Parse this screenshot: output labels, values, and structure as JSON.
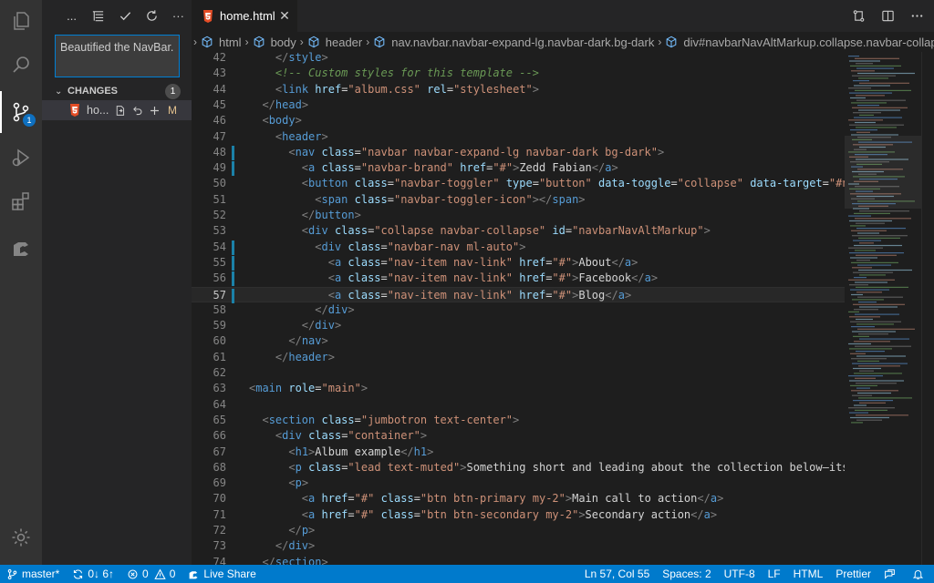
{
  "activity_bar": {
    "items": [
      "explorer-icon",
      "search-icon",
      "source-control-icon",
      "run-debug-icon",
      "extensions-icon",
      "live-share-icon"
    ],
    "scm_badge": "1"
  },
  "sidebar": {
    "toolbar": {
      "more_label": "...",
      "overflow_label": "···"
    },
    "commit_message": "Beautified the NavBar.",
    "changes": {
      "title": "CHANGES",
      "count": "1",
      "files": [
        {
          "name": "home.html",
          "short": "ho...",
          "status": "M"
        }
      ]
    }
  },
  "editor": {
    "tab": {
      "title": "home.html"
    },
    "breadcrumb": [
      "html",
      "body",
      "header",
      "nav.navbar.navbar-expand-lg.navbar-dark.bg-dark",
      "div#navbarNavAltMarkup.collapse.navbar-collapse"
    ],
    "current_line": 57,
    "lines": [
      {
        "n": 42,
        "indent": 2,
        "mod": false,
        "toks": [
          [
            "ang",
            "</"
          ],
          [
            "tag",
            "style"
          ],
          [
            "ang",
            ">"
          ]
        ]
      },
      {
        "n": 43,
        "indent": 2,
        "mod": false,
        "toks": [
          [
            "com",
            "<!-- Custom styles for this template -->"
          ]
        ]
      },
      {
        "n": 44,
        "indent": 2,
        "mod": false,
        "toks": [
          [
            "ang",
            "<"
          ],
          [
            "tag",
            "link"
          ],
          [
            "txt",
            " "
          ],
          [
            "attr",
            "href"
          ],
          [
            "eq",
            "="
          ],
          [
            "str",
            "\"album.css\""
          ],
          [
            "txt",
            " "
          ],
          [
            "attr",
            "rel"
          ],
          [
            "eq",
            "="
          ],
          [
            "str",
            "\"stylesheet\""
          ],
          [
            "ang",
            ">"
          ]
        ]
      },
      {
        "n": 45,
        "indent": 1,
        "mod": false,
        "toks": [
          [
            "ang",
            "</"
          ],
          [
            "tag",
            "head"
          ],
          [
            "ang",
            ">"
          ]
        ]
      },
      {
        "n": 46,
        "indent": 1,
        "mod": false,
        "toks": [
          [
            "ang",
            "<"
          ],
          [
            "tag",
            "body"
          ],
          [
            "ang",
            ">"
          ]
        ]
      },
      {
        "n": 47,
        "indent": 2,
        "mod": false,
        "toks": [
          [
            "ang",
            "<"
          ],
          [
            "tag",
            "header"
          ],
          [
            "ang",
            ">"
          ]
        ]
      },
      {
        "n": 48,
        "indent": 3,
        "mod": true,
        "toks": [
          [
            "ang",
            "<"
          ],
          [
            "tag",
            "nav"
          ],
          [
            "txt",
            " "
          ],
          [
            "attr",
            "class"
          ],
          [
            "eq",
            "="
          ],
          [
            "str",
            "\"navbar navbar-expand-lg navbar-dark bg-dark\""
          ],
          [
            "ang",
            ">"
          ]
        ]
      },
      {
        "n": 49,
        "indent": 4,
        "mod": true,
        "toks": [
          [
            "ang",
            "<"
          ],
          [
            "tag",
            "a"
          ],
          [
            "txt",
            " "
          ],
          [
            "attr",
            "class"
          ],
          [
            "eq",
            "="
          ],
          [
            "str",
            "\"navbar-brand\""
          ],
          [
            "txt",
            " "
          ],
          [
            "attr",
            "href"
          ],
          [
            "eq",
            "="
          ],
          [
            "str",
            "\"#\""
          ],
          [
            "ang",
            ">"
          ],
          [
            "txt",
            "Zedd Fabian"
          ],
          [
            "ang",
            "</"
          ],
          [
            "tag",
            "a"
          ],
          [
            "ang",
            ">"
          ]
        ]
      },
      {
        "n": 50,
        "indent": 4,
        "mod": false,
        "toks": [
          [
            "ang",
            "<"
          ],
          [
            "tag",
            "button"
          ],
          [
            "txt",
            " "
          ],
          [
            "attr",
            "class"
          ],
          [
            "eq",
            "="
          ],
          [
            "str",
            "\"navbar-toggler\""
          ],
          [
            "txt",
            " "
          ],
          [
            "attr",
            "type"
          ],
          [
            "eq",
            "="
          ],
          [
            "str",
            "\"button\""
          ],
          [
            "txt",
            " "
          ],
          [
            "attr",
            "data-toggle"
          ],
          [
            "eq",
            "="
          ],
          [
            "str",
            "\"collapse\""
          ],
          [
            "txt",
            " "
          ],
          [
            "attr",
            "data-target"
          ],
          [
            "eq",
            "="
          ],
          [
            "str",
            "\"#navbarNavAltMarkup\""
          ]
        ]
      },
      {
        "n": 51,
        "indent": 5,
        "mod": false,
        "toks": [
          [
            "ang",
            "<"
          ],
          [
            "tag",
            "span"
          ],
          [
            "txt",
            " "
          ],
          [
            "attr",
            "class"
          ],
          [
            "eq",
            "="
          ],
          [
            "str",
            "\"navbar-toggler-icon\""
          ],
          [
            "ang",
            "></"
          ],
          [
            "tag",
            "span"
          ],
          [
            "ang",
            ">"
          ]
        ]
      },
      {
        "n": 52,
        "indent": 4,
        "mod": false,
        "toks": [
          [
            "ang",
            "</"
          ],
          [
            "tag",
            "button"
          ],
          [
            "ang",
            ">"
          ]
        ]
      },
      {
        "n": 53,
        "indent": 4,
        "mod": false,
        "toks": [
          [
            "ang",
            "<"
          ],
          [
            "tag",
            "div"
          ],
          [
            "txt",
            " "
          ],
          [
            "attr",
            "class"
          ],
          [
            "eq",
            "="
          ],
          [
            "str",
            "\"collapse navbar-collapse\""
          ],
          [
            "txt",
            " "
          ],
          [
            "attr",
            "id"
          ],
          [
            "eq",
            "="
          ],
          [
            "str",
            "\"navbarNavAltMarkup\""
          ],
          [
            "ang",
            ">"
          ]
        ]
      },
      {
        "n": 54,
        "indent": 5,
        "mod": true,
        "toks": [
          [
            "ang",
            "<"
          ],
          [
            "tag",
            "div"
          ],
          [
            "txt",
            " "
          ],
          [
            "attr",
            "class"
          ],
          [
            "eq",
            "="
          ],
          [
            "str",
            "\"navbar-nav ml-auto\""
          ],
          [
            "ang",
            ">"
          ]
        ]
      },
      {
        "n": 55,
        "indent": 6,
        "mod": true,
        "toks": [
          [
            "ang",
            "<"
          ],
          [
            "tag",
            "a"
          ],
          [
            "txt",
            " "
          ],
          [
            "attr",
            "class"
          ],
          [
            "eq",
            "="
          ],
          [
            "str",
            "\"nav-item nav-link\""
          ],
          [
            "txt",
            " "
          ],
          [
            "attr",
            "href"
          ],
          [
            "eq",
            "="
          ],
          [
            "str",
            "\"#\""
          ],
          [
            "ang",
            ">"
          ],
          [
            "txt",
            "About"
          ],
          [
            "ang",
            "</"
          ],
          [
            "tag",
            "a"
          ],
          [
            "ang",
            ">"
          ]
        ]
      },
      {
        "n": 56,
        "indent": 6,
        "mod": true,
        "toks": [
          [
            "ang",
            "<"
          ],
          [
            "tag",
            "a"
          ],
          [
            "txt",
            " "
          ],
          [
            "attr",
            "class"
          ],
          [
            "eq",
            "="
          ],
          [
            "str",
            "\"nav-item nav-link\""
          ],
          [
            "txt",
            " "
          ],
          [
            "attr",
            "href"
          ],
          [
            "eq",
            "="
          ],
          [
            "str",
            "\"#\""
          ],
          [
            "ang",
            ">"
          ],
          [
            "txt",
            "Facebook"
          ],
          [
            "ang",
            "</"
          ],
          [
            "tag",
            "a"
          ],
          [
            "ang",
            ">"
          ]
        ]
      },
      {
        "n": 57,
        "indent": 6,
        "mod": true,
        "toks": [
          [
            "ang",
            "<"
          ],
          [
            "tag",
            "a"
          ],
          [
            "txt",
            " "
          ],
          [
            "attr",
            "class"
          ],
          [
            "eq",
            "="
          ],
          [
            "str",
            "\"nav-item nav-link\""
          ],
          [
            "txt",
            " "
          ],
          [
            "attr",
            "href"
          ],
          [
            "eq",
            "="
          ],
          [
            "str",
            "\"#\""
          ],
          [
            "ang",
            ">"
          ],
          [
            "txt",
            "Blog"
          ],
          [
            "ang",
            "</"
          ],
          [
            "tag",
            "a"
          ],
          [
            "ang",
            ">"
          ]
        ]
      },
      {
        "n": 58,
        "indent": 5,
        "mod": false,
        "toks": [
          [
            "ang",
            "</"
          ],
          [
            "tag",
            "div"
          ],
          [
            "ang",
            ">"
          ]
        ]
      },
      {
        "n": 59,
        "indent": 4,
        "mod": false,
        "toks": [
          [
            "ang",
            "</"
          ],
          [
            "tag",
            "div"
          ],
          [
            "ang",
            ">"
          ]
        ]
      },
      {
        "n": 60,
        "indent": 3,
        "mod": false,
        "toks": [
          [
            "ang",
            "</"
          ],
          [
            "tag",
            "nav"
          ],
          [
            "ang",
            ">"
          ]
        ]
      },
      {
        "n": 61,
        "indent": 2,
        "mod": false,
        "toks": [
          [
            "ang",
            "</"
          ],
          [
            "tag",
            "header"
          ],
          [
            "ang",
            ">"
          ]
        ]
      },
      {
        "n": 62,
        "indent": 0,
        "mod": false,
        "toks": []
      },
      {
        "n": 63,
        "indent": 0,
        "mod": false,
        "toks": [
          [
            "ang",
            "<"
          ],
          [
            "tag",
            "main"
          ],
          [
            "txt",
            " "
          ],
          [
            "attr",
            "role"
          ],
          [
            "eq",
            "="
          ],
          [
            "str",
            "\"main\""
          ],
          [
            "ang",
            ">"
          ]
        ]
      },
      {
        "n": 64,
        "indent": 0,
        "mod": false,
        "toks": []
      },
      {
        "n": 65,
        "indent": 1,
        "mod": false,
        "toks": [
          [
            "ang",
            "<"
          ],
          [
            "tag",
            "section"
          ],
          [
            "txt",
            " "
          ],
          [
            "attr",
            "class"
          ],
          [
            "eq",
            "="
          ],
          [
            "str",
            "\"jumbotron text-center\""
          ],
          [
            "ang",
            ">"
          ]
        ]
      },
      {
        "n": 66,
        "indent": 2,
        "mod": false,
        "toks": [
          [
            "ang",
            "<"
          ],
          [
            "tag",
            "div"
          ],
          [
            "txt",
            " "
          ],
          [
            "attr",
            "class"
          ],
          [
            "eq",
            "="
          ],
          [
            "str",
            "\"container\""
          ],
          [
            "ang",
            ">"
          ]
        ]
      },
      {
        "n": 67,
        "indent": 3,
        "mod": false,
        "toks": [
          [
            "ang",
            "<"
          ],
          [
            "tag",
            "h1"
          ],
          [
            "ang",
            ">"
          ],
          [
            "txt",
            "Album example"
          ],
          [
            "ang",
            "</"
          ],
          [
            "tag",
            "h1"
          ],
          [
            "ang",
            ">"
          ]
        ]
      },
      {
        "n": 68,
        "indent": 3,
        "mod": false,
        "toks": [
          [
            "ang",
            "<"
          ],
          [
            "tag",
            "p"
          ],
          [
            "txt",
            " "
          ],
          [
            "attr",
            "class"
          ],
          [
            "eq",
            "="
          ],
          [
            "str",
            "\"lead text-muted\""
          ],
          [
            "ang",
            ">"
          ],
          [
            "txt",
            "Something short and leading about the collection below—its contents"
          ]
        ]
      },
      {
        "n": 69,
        "indent": 3,
        "mod": false,
        "toks": [
          [
            "ang",
            "<"
          ],
          [
            "tag",
            "p"
          ],
          [
            "ang",
            ">"
          ]
        ]
      },
      {
        "n": 70,
        "indent": 4,
        "mod": false,
        "toks": [
          [
            "ang",
            "<"
          ],
          [
            "tag",
            "a"
          ],
          [
            "txt",
            " "
          ],
          [
            "attr",
            "href"
          ],
          [
            "eq",
            "="
          ],
          [
            "str",
            "\"#\""
          ],
          [
            "txt",
            " "
          ],
          [
            "attr",
            "class"
          ],
          [
            "eq",
            "="
          ],
          [
            "str",
            "\"btn btn-primary my-2\""
          ],
          [
            "ang",
            ">"
          ],
          [
            "txt",
            "Main call to action"
          ],
          [
            "ang",
            "</"
          ],
          [
            "tag",
            "a"
          ],
          [
            "ang",
            ">"
          ]
        ]
      },
      {
        "n": 71,
        "indent": 4,
        "mod": false,
        "toks": [
          [
            "ang",
            "<"
          ],
          [
            "tag",
            "a"
          ],
          [
            "txt",
            " "
          ],
          [
            "attr",
            "href"
          ],
          [
            "eq",
            "="
          ],
          [
            "str",
            "\"#\""
          ],
          [
            "txt",
            " "
          ],
          [
            "attr",
            "class"
          ],
          [
            "eq",
            "="
          ],
          [
            "str",
            "\"btn btn-secondary my-2\""
          ],
          [
            "ang",
            ">"
          ],
          [
            "txt",
            "Secondary action"
          ],
          [
            "ang",
            "</"
          ],
          [
            "tag",
            "a"
          ],
          [
            "ang",
            ">"
          ]
        ]
      },
      {
        "n": 72,
        "indent": 3,
        "mod": false,
        "toks": [
          [
            "ang",
            "</"
          ],
          [
            "tag",
            "p"
          ],
          [
            "ang",
            ">"
          ]
        ]
      },
      {
        "n": 73,
        "indent": 2,
        "mod": false,
        "toks": [
          [
            "ang",
            "</"
          ],
          [
            "tag",
            "div"
          ],
          [
            "ang",
            ">"
          ]
        ]
      },
      {
        "n": 74,
        "indent": 1,
        "mod": false,
        "toks": [
          [
            "ang",
            "</"
          ],
          [
            "tag",
            "section"
          ],
          [
            "ang",
            ">"
          ]
        ]
      }
    ]
  },
  "statusbar": {
    "branch": "master*",
    "sync": "0↓ 6↑",
    "errors": "0",
    "warnings": "0",
    "live_share": "Live Share",
    "cursor": "Ln 57, Col 55",
    "spaces": "Spaces: 2",
    "encoding": "UTF-8",
    "eol": "LF",
    "language": "HTML",
    "formatter": "Prettier"
  },
  "colors": {
    "accent": "#007acc",
    "html_icon": "#e44d26",
    "modified": "#e2c08d",
    "gutter_modified": "#1b81a8"
  }
}
